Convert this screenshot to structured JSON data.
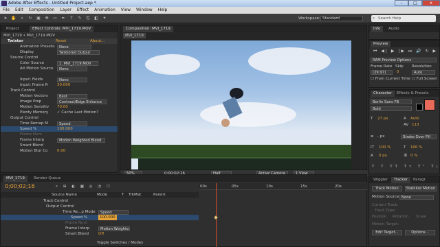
{
  "window": {
    "title": "Adobe After Effects - Untitled Project.aep *",
    "min": "–",
    "max": "□",
    "close": "x"
  },
  "menu": [
    "File",
    "Edit",
    "Composition",
    "Layer",
    "Effect",
    "Animation",
    "View",
    "Window",
    "Help"
  ],
  "toolbar": {
    "workspace_label": "Workspace:",
    "workspace_value": "Standard",
    "search_placeholder": "Search Help"
  },
  "project_panel": {
    "tabs": [
      "Project",
      "Effect Controls: MVI_1719.MOV"
    ],
    "breadcrumb": "MVI_1719 • MVI_1719.MOV",
    "effect_name": "Twixtor",
    "reset": "Reset",
    "about": "About...",
    "rows": [
      {
        "label": "Animation Presets:",
        "value": "None"
      },
      {
        "label": "Display",
        "value": "Twixtored Output"
      },
      {
        "label": "Source Control",
        "value": ""
      },
      {
        "label": "Color Source",
        "value": "1. MVI_1719.MOV"
      },
      {
        "label": "Alt Motion Source",
        "value": "None"
      },
      {
        "label": "Input: Fields",
        "value": "None"
      },
      {
        "label": "Input: Frame R",
        "value": "30.000"
      },
      {
        "label": "Track Control",
        "value": ""
      },
      {
        "label": "Motion Vectors",
        "value": "Best"
      },
      {
        "label": "Image Prep",
        "value": "Contrast/Edge Enhance"
      },
      {
        "label": "Motion Sensitiv",
        "value": "70.00"
      },
      {
        "label": "Plenty Memory",
        "value": "Cache Last Motion?"
      },
      {
        "label": "Output Control",
        "value": ""
      },
      {
        "label": "Time Remap M",
        "value": "Speed"
      },
      {
        "label": "Speed %",
        "value": "100.000"
      },
      {
        "label": "Frame Num",
        "value": ""
      },
      {
        "label": "Frame Interp",
        "value": "Motion Weighted Blend"
      },
      {
        "label": "Smart Blend",
        "value": ""
      },
      {
        "label": "Motion Blur Co",
        "value": "0.00"
      }
    ]
  },
  "viewer": {
    "tab": "Composition: MVI_1719",
    "comp_label": "MVI_1719",
    "zoom": "50%",
    "timecode": "0;00;02;16",
    "resolution": "Half",
    "camera": "Active Camera",
    "view": "1 View"
  },
  "info_panel": {
    "tabs": [
      "Info",
      "Audio"
    ]
  },
  "preview_panel": {
    "title": "Preview",
    "ram_label": "RAM Preview Options",
    "frame_rate_label": "Frame Rate",
    "skip_label": "Skip",
    "resolution_label": "Resolution",
    "frame_rate": "(29.97)",
    "skip": "0",
    "resolution": "Auto",
    "from_current": "From Current Time",
    "full_screen": "Full Screen"
  },
  "character_panel": {
    "tabs": [
      "Character",
      "Effects & Presets"
    ],
    "font": "Berlin Sans FB",
    "style": "Bold",
    "size": "27 px",
    "leading": "Auto",
    "tracking": "113",
    "stroke": "Stroke Over Fill",
    "stroke_px": "- px",
    "scale_v": "100 %",
    "scale_h": "100 %",
    "baseline": "0 px",
    "tsume": "0 %",
    "accent": "#e86a5a"
  },
  "tracker_panel": {
    "tabs": [
      "Wiggler",
      "Tracker",
      "Paragr"
    ],
    "track_motion": "Track Motion",
    "stabilize": "Stabilize Motion",
    "motion_source_label": "Motion Source:",
    "motion_source": "None",
    "current_track": "Current Track:",
    "track_type": "Track Type:",
    "position": "Position",
    "rotation": "Rotation",
    "scale": "Scale",
    "motion_target": "Motion Target:",
    "edit_target": "Edit Target...",
    "options": "Options..."
  },
  "timeline": {
    "tabs": [
      "MVI_1719",
      "Render Queue"
    ],
    "timecode": "0;00;02;16",
    "columns": [
      "Source Name",
      "Mode",
      "T",
      "TrkMat",
      "Parent"
    ],
    "ruler": [
      "00s",
      "05s",
      "10s",
      "15s",
      "20s"
    ],
    "rows": [
      {
        "name": "Track Control",
        "mode": ""
      },
      {
        "name": "Output Control",
        "mode": ""
      },
      {
        "name": "Time Re...p Mode",
        "mode": "Speed"
      },
      {
        "name": "Speed %",
        "mode": "100.000"
      },
      {
        "name": "Frame Num",
        "mode": ""
      },
      {
        "name": "Frame Interp",
        "mode": "Motion Weighte"
      },
      {
        "name": "Smart Blend",
        "mode": "Off"
      }
    ],
    "footer": "Toggle Switches / Modes"
  }
}
